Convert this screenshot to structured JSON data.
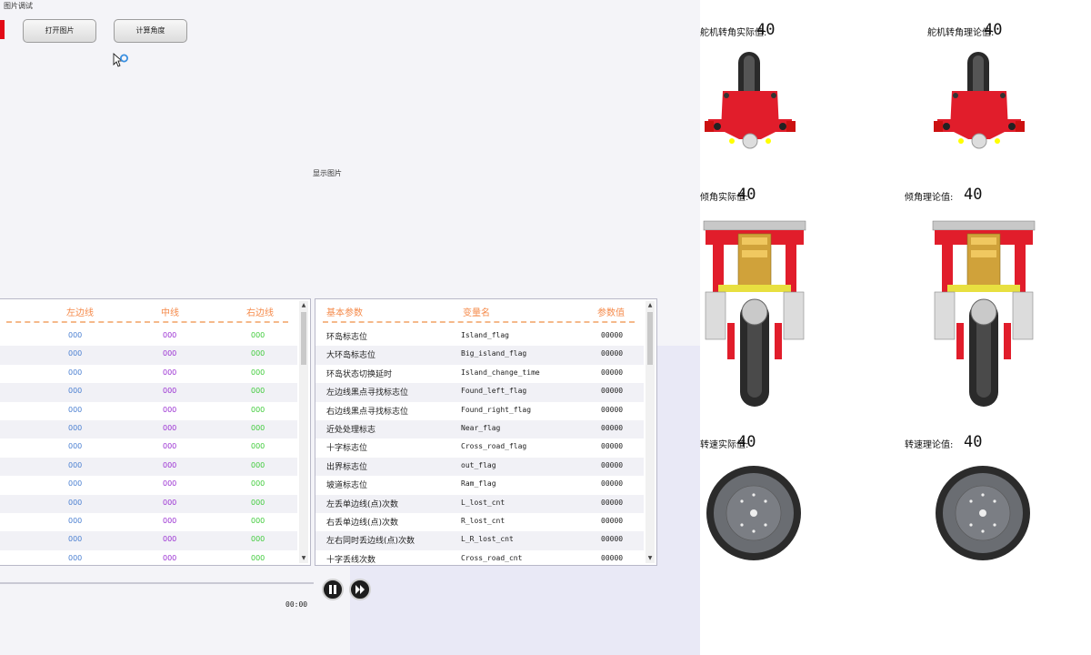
{
  "window_title": "图片调试",
  "toolbar": {
    "open_image": "打开图片",
    "calc_angle": "计算角度"
  },
  "image_label": "显示图片",
  "line_table": {
    "headers": [
      "左边线",
      "中线",
      "右边线"
    ],
    "rows": [
      [
        "000",
        "000",
        "000"
      ],
      [
        "000",
        "000",
        "000"
      ],
      [
        "000",
        "000",
        "000"
      ],
      [
        "000",
        "000",
        "000"
      ],
      [
        "000",
        "000",
        "000"
      ],
      [
        "000",
        "000",
        "000"
      ],
      [
        "000",
        "000",
        "000"
      ],
      [
        "000",
        "000",
        "000"
      ],
      [
        "000",
        "000",
        "000"
      ],
      [
        "000",
        "000",
        "000"
      ],
      [
        "000",
        "000",
        "000"
      ],
      [
        "000",
        "000",
        "000"
      ],
      [
        "000",
        "000",
        "000"
      ]
    ]
  },
  "param_table": {
    "headers": [
      "基本参数",
      "变量名",
      "参数值"
    ],
    "rows": [
      [
        "环岛标志位",
        "Island_flag",
        "00000"
      ],
      [
        "大环岛标志位",
        "Big_island_flag",
        "00000"
      ],
      [
        "环岛状态切换延时",
        "Island_change_time",
        "00000"
      ],
      [
        "左边线黑点寻找标志位",
        "Found_left_flag",
        "00000"
      ],
      [
        "右边线黑点寻找标志位",
        "Found_right_flag",
        "00000"
      ],
      [
        "近处处理标志",
        "Near_flag",
        "00000"
      ],
      [
        "十字标志位",
        "Cross_road_flag",
        "00000"
      ],
      [
        "出界标志位",
        "out_flag",
        "00000"
      ],
      [
        "坡道标志位",
        "Ram_flag",
        "00000"
      ],
      [
        "左丢单边线(点)次数",
        "L_lost_cnt",
        "00000"
      ],
      [
        "右丢单边线(点)次数",
        "R_lost_cnt",
        "00000"
      ],
      [
        "左右同时丢边线(点)次数",
        "L_R_lost_cnt",
        "00000"
      ],
      [
        "十字丢线次数",
        "Cross_road_cnt",
        "00000"
      ]
    ]
  },
  "playback": {
    "time": "00:00"
  },
  "gauges": {
    "servo_actual": {
      "label": "舵机转角实际值:",
      "value": "40"
    },
    "servo_theory": {
      "label": "舵机转角理论值:",
      "value": "40"
    },
    "tilt_actual": {
      "label": "倾角实际值:",
      "value": "40"
    },
    "tilt_theory": {
      "label": "倾角理论值:",
      "value": "40"
    },
    "speed_actual": {
      "label": "转速实际值:",
      "value": "40"
    },
    "speed_theory": {
      "label": "转速理论值:",
      "value": "40"
    }
  }
}
